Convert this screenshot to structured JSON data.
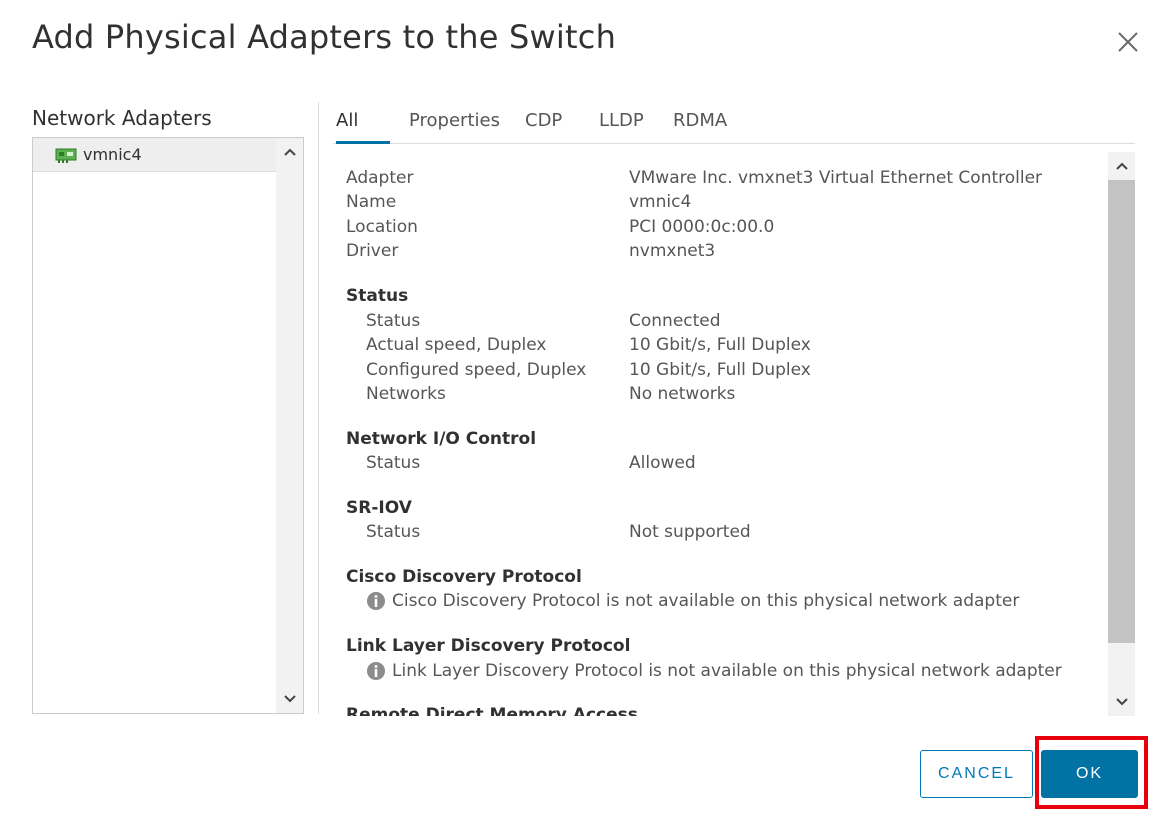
{
  "dialog": {
    "title": "Add Physical Adapters to the Switch",
    "close_icon": "close-icon"
  },
  "left_panel": {
    "label": "Network Adapters",
    "items": [
      {
        "label": "vmnic4",
        "icon": "network-card-icon",
        "selected": true
      }
    ]
  },
  "tabs": [
    {
      "label": "All",
      "active": true
    },
    {
      "label": "Properties",
      "active": false
    },
    {
      "label": "CDP",
      "active": false
    },
    {
      "label": "LLDP",
      "active": false
    },
    {
      "label": "RDMA",
      "active": false
    }
  ],
  "details": {
    "general": [
      {
        "key": "Adapter",
        "value": "VMware Inc. vmxnet3 Virtual Ethernet Controller"
      },
      {
        "key": "Name",
        "value": "vmnic4"
      },
      {
        "key": "Location",
        "value": "PCI 0000:0c:00.0"
      },
      {
        "key": "Driver",
        "value": "nvmxnet3"
      }
    ],
    "status_section": {
      "title": "Status",
      "rows": [
        {
          "key": "Status",
          "value": "Connected"
        },
        {
          "key": "Actual speed, Duplex",
          "value": "10 Gbit/s, Full Duplex"
        },
        {
          "key": "Configured speed, Duplex",
          "value": "10 Gbit/s, Full Duplex"
        },
        {
          "key": "Networks",
          "value": "No networks"
        }
      ]
    },
    "nioc_section": {
      "title": "Network I/O Control",
      "rows": [
        {
          "key": "Status",
          "value": "Allowed"
        }
      ]
    },
    "sriov_section": {
      "title": "SR-IOV",
      "rows": [
        {
          "key": "Status",
          "value": "Not supported"
        }
      ]
    },
    "cdp_section": {
      "title": "Cisco Discovery Protocol",
      "info": "Cisco Discovery Protocol is not available on this physical network adapter"
    },
    "lldp_section": {
      "title": "Link Layer Discovery Protocol",
      "info": "Link Layer Discovery Protocol is not available on this physical network adapter"
    },
    "rdma_section": {
      "title": "Remote Direct Memory Access"
    }
  },
  "footer": {
    "cancel_label": "CANCEL",
    "ok_label": "OK"
  },
  "colors": {
    "accent": "#0072a3",
    "highlight": "#e8000b"
  }
}
